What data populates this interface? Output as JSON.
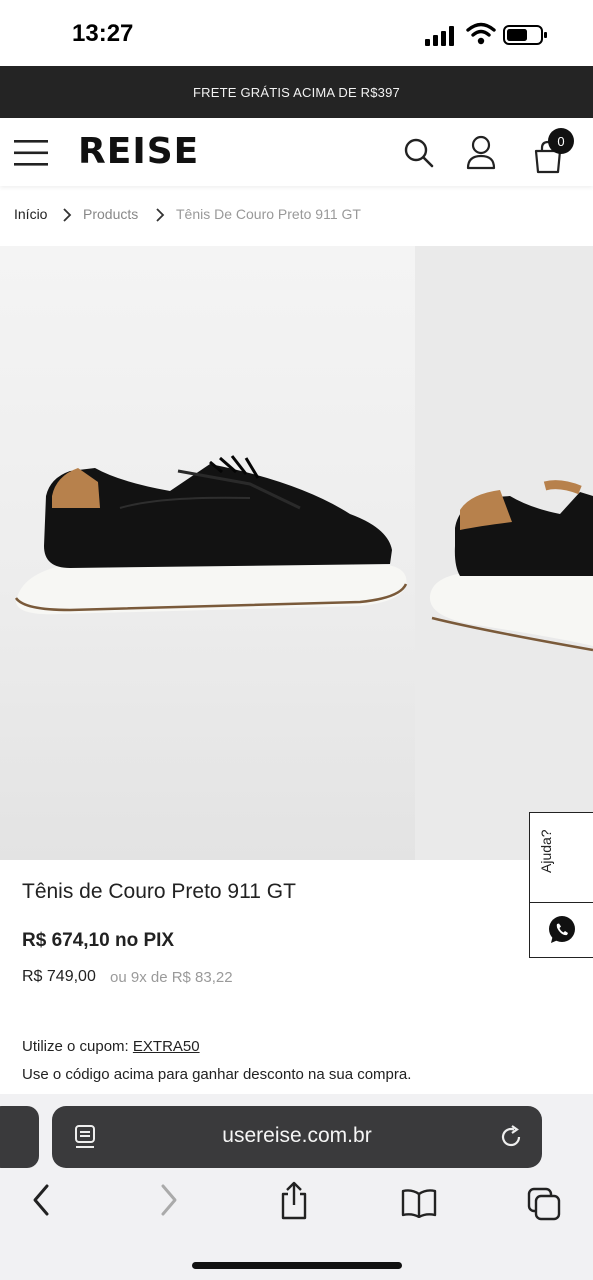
{
  "status_bar": {
    "time": "13:27"
  },
  "promo_banner": {
    "text": "FRETE GRÁTIS ACIMA DE R$397"
  },
  "header": {
    "brand": "REISE",
    "cart_count": "0"
  },
  "breadcrumb": {
    "items": [
      "Início",
      "Products",
      "Tênis De Couro Preto 911 GT"
    ]
  },
  "product": {
    "title": "Tênis de Couro Preto 911 GT",
    "pix_price": "R$ 674,10 no PIX",
    "regular_price": "R$ 749,00",
    "installments": "ou 9x de R$ 83,22",
    "coupon_label": "Utilize o cupom:",
    "coupon_code": "EXTRA50",
    "coupon_note": "Use o código acima para ganhar desconto na sua compra."
  },
  "help_widget": {
    "label": "Ajuda?"
  },
  "browser": {
    "url": "usereise.com.br"
  },
  "colors": {
    "promo_bg": "#242424",
    "whatsapp_green": "#25D366",
    "url_bar": "#3a3a3c"
  },
  "icons": [
    "signal-icon",
    "wifi-icon",
    "battery-icon",
    "menu-icon",
    "search-icon",
    "user-icon",
    "bag-icon",
    "chevron-right-icon",
    "whatsapp-icon",
    "tabs-overview-icon",
    "reload-icon",
    "back-icon",
    "forward-icon",
    "share-icon",
    "bookmarks-icon",
    "tabs-icon"
  ]
}
